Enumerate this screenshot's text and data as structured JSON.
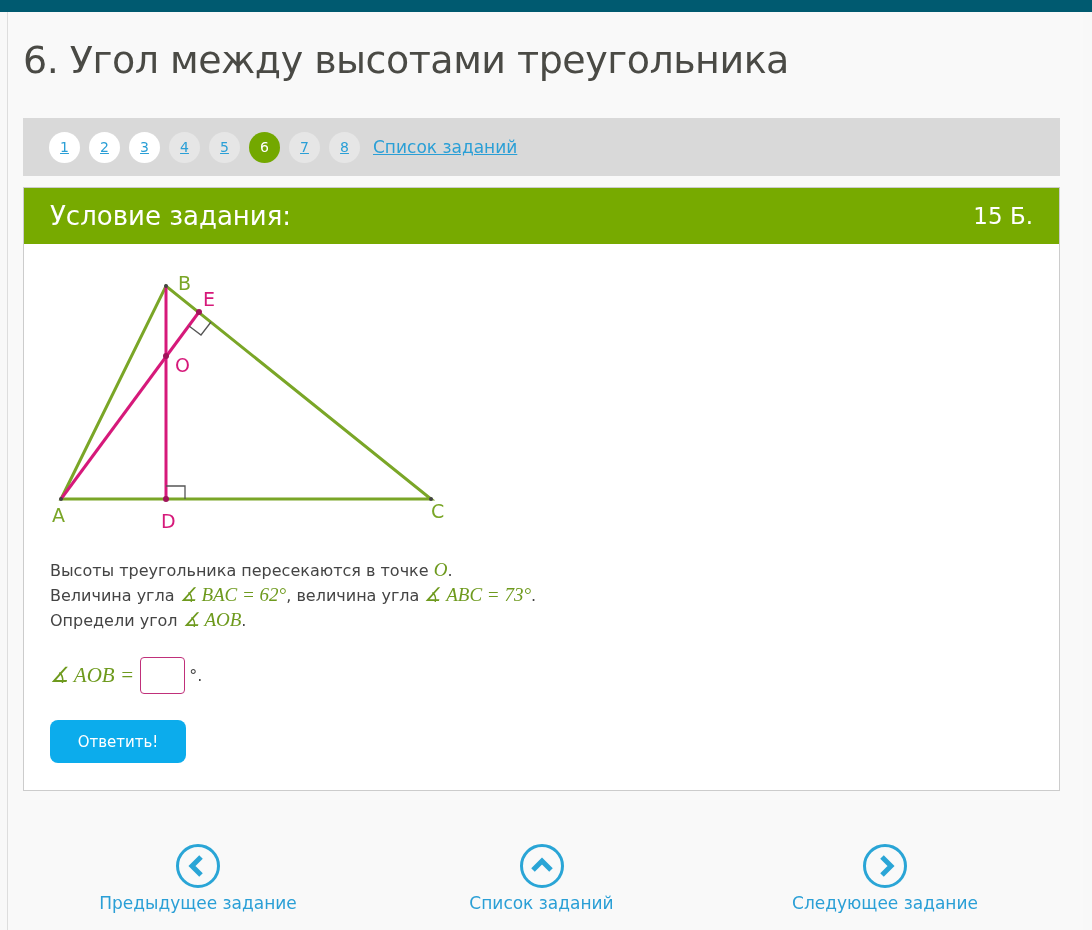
{
  "title": "6. Угол между высотами треугольника",
  "pagination": {
    "pages": [
      {
        "label": "1",
        "selected": false,
        "visited": true
      },
      {
        "label": "2",
        "selected": false,
        "visited": true
      },
      {
        "label": "3",
        "selected": false,
        "visited": true
      },
      {
        "label": "4",
        "selected": false,
        "visited": false
      },
      {
        "label": "5",
        "selected": false,
        "visited": false
      },
      {
        "label": "6",
        "selected": true,
        "visited": false
      },
      {
        "label": "7",
        "selected": false,
        "visited": false
      },
      {
        "label": "8",
        "selected": false,
        "visited": false
      }
    ],
    "list_link": "Список заданий"
  },
  "task": {
    "heading": "Условие задания:",
    "points": "15 Б.",
    "figure_labels": [
      "B",
      "E",
      "O",
      "A",
      "D",
      "C"
    ],
    "statement": [
      "Высоты треугольника пересекаются в точке *O*.",
      "Величина угла *∡ BAC = 62°*, величина угла *∡ ABC = 73°*.",
      "Определи угол *∡ AOB*."
    ],
    "answer": {
      "prefix": "∡ AOB =",
      "suffix": "°."
    },
    "submit": "Ответить!"
  },
  "nav": [
    {
      "kind": "prev",
      "label": "Предыдущее задание"
    },
    {
      "kind": "up",
      "label": "Список заданий"
    },
    {
      "kind": "next",
      "label": "Следующее задание"
    }
  ]
}
